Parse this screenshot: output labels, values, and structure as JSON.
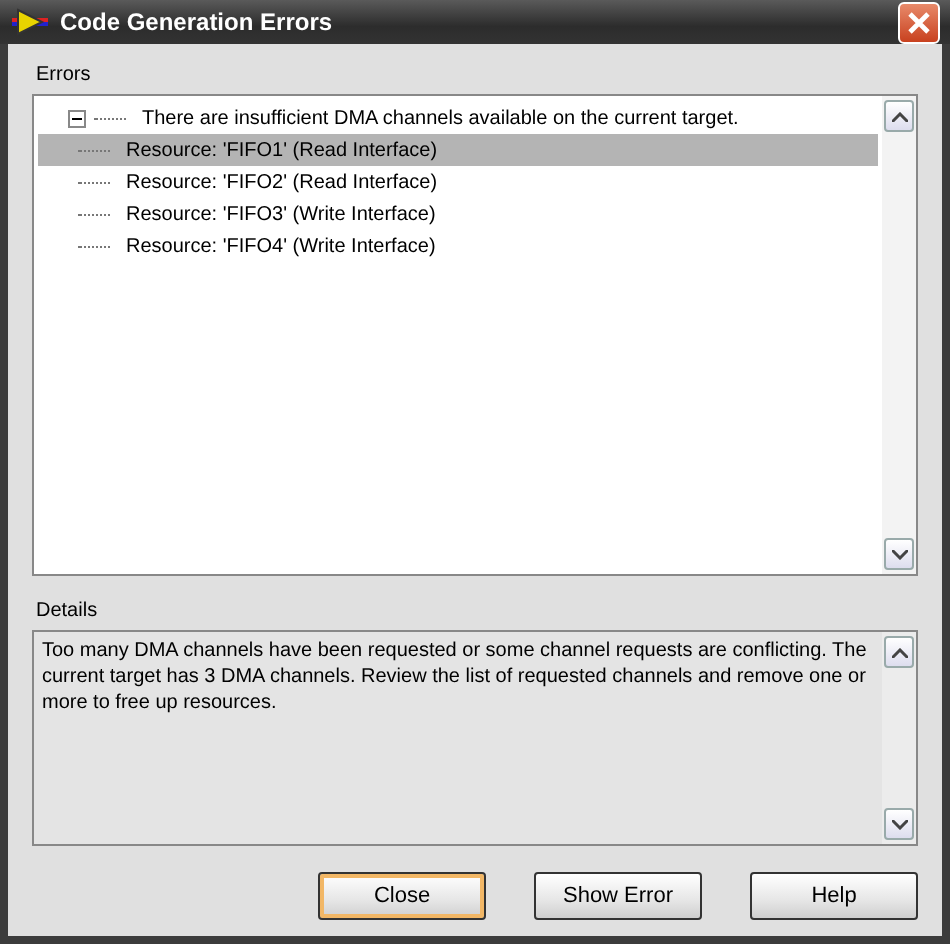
{
  "window": {
    "title": "Code Generation Errors"
  },
  "errors": {
    "label": "Errors",
    "tree": [
      {
        "text": "There are insufficient DMA channels available on the current target.",
        "expanded": true,
        "selected": false,
        "children": [
          {
            "text": "Resource: 'FIFO1' (Read Interface)",
            "selected": true
          },
          {
            "text": "Resource: 'FIFO2' (Read Interface)",
            "selected": false
          },
          {
            "text": "Resource: 'FIFO3' (Write Interface)",
            "selected": false
          },
          {
            "text": "Resource: 'FIFO4' (Write Interface)",
            "selected": false
          }
        ]
      }
    ]
  },
  "details": {
    "label": "Details",
    "text": "Too many DMA channels have been requested or some channel requests are conflicting. The current target has 3 DMA channels. Review the list of requested channels and remove one or more to free up resources."
  },
  "buttons": [
    {
      "label": "Close",
      "default": true
    },
    {
      "label": "Show Error",
      "default": false
    },
    {
      "label": "Help",
      "default": false
    }
  ]
}
